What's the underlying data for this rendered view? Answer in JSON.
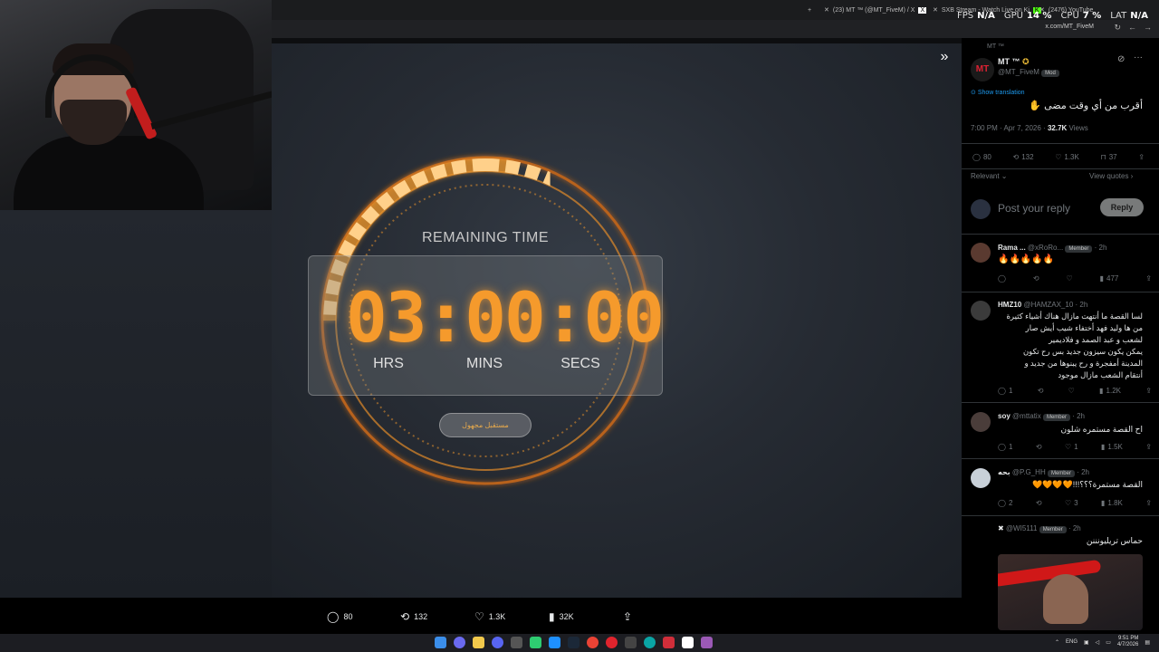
{
  "browser": {
    "tabs": [
      {
        "label": "(23) MT ™ (@MT_FiveM) / X"
      },
      {
        "label": "SXB Stream - Watch Live on Ki"
      },
      {
        "label": "(2476) YouTube"
      }
    ],
    "url": "x.com/MT_FiveM",
    "stats": {
      "fps_label": "FPS",
      "fps_value": "N/A",
      "gpu_label": "GPU",
      "gpu_value": "14 %",
      "cpu_label": "CPU",
      "cpu_value": "7 %",
      "lat_label": "LAT",
      "lat_value": "N/A"
    }
  },
  "countdown": {
    "heading": "REMAINING TIME",
    "digits": "03:00:00",
    "units": {
      "hrs": "HRS",
      "mins": "MINS",
      "secs": "SECS"
    },
    "pill": "مستقبل مجهول",
    "accent": "#f59a2c"
  },
  "video_stats": {
    "replies": "80",
    "reposts": "132",
    "likes": "1.3K",
    "views": "32K"
  },
  "post": {
    "header_label": "MT ™",
    "author": "MT ™",
    "handle": "@MT_FiveM",
    "badge": "Mod",
    "show_translation": "Show translation",
    "text": "أقرب من أي وقت مضى ✋",
    "time": "7:00 PM · Apr 7, 2026 ·",
    "views_value": "32.7K",
    "views_label": "Views",
    "replies": "80",
    "reposts": "132",
    "likes": "1.3K",
    "bookmarks": "37",
    "sort_label": "Relevant",
    "view_quotes": "View quotes",
    "reply_placeholder": "Post your reply",
    "reply_button": "Reply"
  },
  "replies": [
    {
      "name": "Rama ...",
      "handle": "@xRoRo...",
      "badge": "Member",
      "time": "· 2h",
      "text": "🔥🔥🔥🔥🔥",
      "replies": "",
      "reposts": "",
      "likes": "",
      "views": "477"
    },
    {
      "name": "HMZ10",
      "handle": "@HAMZAX_10",
      "badge": "",
      "time": "· 2h",
      "lines": [
        "لسا القصة ما أنتهت مازال هناك أشياء كثيرة",
        "من ها وليد فهد أختفاء شيب أيش صار",
        "لشعب و عبد الصمد و فلاديمير",
        "يمكن يكون سيزون جديد بس رح تكون",
        "المدينة أمفجرة و رح يبنوها من جديد و",
        "أنتقام الشعب مازال موجود"
      ],
      "replies": "1",
      "reposts": "",
      "likes": "",
      "views": "1.2K"
    },
    {
      "name": "soy",
      "handle": "@mttatix",
      "badge": "Member",
      "time": "· 2h",
      "text": "اح القصة مستمره شلون",
      "replies": "1",
      "reposts": "",
      "likes": "1",
      "views": "1.5K"
    },
    {
      "name": "بحه",
      "handle": "@P.G_HH",
      "badge": "Member",
      "time": "· 2h",
      "text": "القصة مستمرة؟؟؟!!!🧡🧡🧡🧡",
      "replies": "2",
      "reposts": "",
      "likes": "3",
      "views": "1.8K"
    },
    {
      "name": "✖",
      "handle": "@WI5111",
      "badge": "Member",
      "time": "· 2h",
      "text": "حماس تريليونننن"
    }
  ],
  "taskbar": {
    "lang": "ENG",
    "time": "9:51 PM",
    "date": "4/7/2026"
  }
}
